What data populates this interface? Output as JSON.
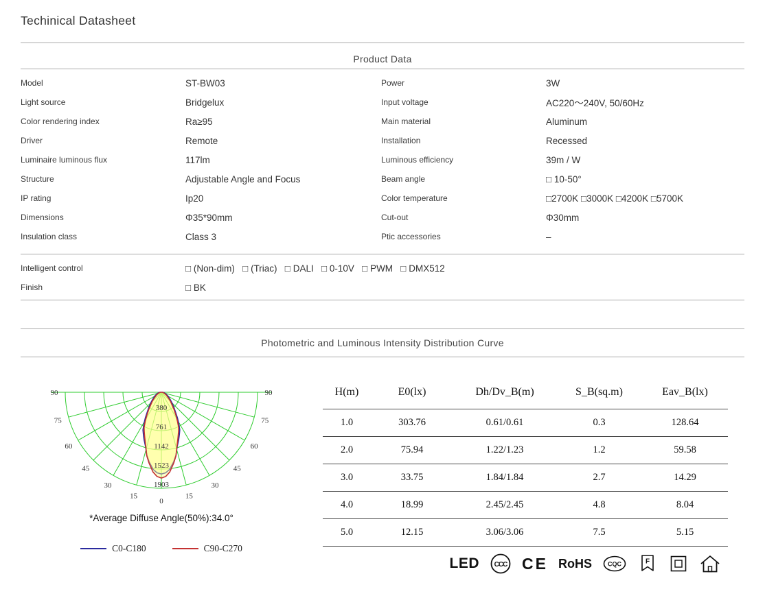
{
  "page": {
    "title": "Techinical Datasheet"
  },
  "product_data": {
    "section_title": "Product Data",
    "left_rows": [
      {
        "label": "Model",
        "value": "ST-BW03"
      },
      {
        "label": "Light source",
        "value": "Bridgelux"
      },
      {
        "label": "Color rendering index",
        "value": "Ra≥95"
      },
      {
        "label": "Driver",
        "value": "Remote"
      },
      {
        "label": "Luminaire luminous flux",
        "value": "117lm"
      },
      {
        "label": "Structure",
        "value": "Adjustable Angle and Focus"
      },
      {
        "label": "IP  rating",
        "value": "Ip20"
      },
      {
        "label": "Dimensions",
        "value": "Φ35*90mm"
      },
      {
        "label": "Insulation class",
        "value": "Class 3"
      }
    ],
    "right_rows": [
      {
        "label": "Power",
        "value": "3W"
      },
      {
        "label": "Input voltage",
        "value": "AC220～240V, 50/60Hz"
      },
      {
        "label": "Main material",
        "value": "Aluminum"
      },
      {
        "label": "Installation",
        "value": "Recessed"
      },
      {
        "label": "Luminous efficiency",
        "value": "39m / W"
      },
      {
        "label": "Beam angle",
        "value": "□ 10-50°"
      },
      {
        "label": "Color temperature",
        "value": "□2700K □3000K □4200K □5700K"
      },
      {
        "label": "Cut-out",
        "value": "Φ30mm"
      },
      {
        "label": "Ptic accessories",
        "value": "–"
      }
    ],
    "full_rows": [
      {
        "label": "Intelligent control",
        "value": "□ (Non-dim)   □ (Triac)   □ DALI   □ 0-10V   □ PWM   □ DMX512"
      },
      {
        "label": "Finish",
        "value": "□ BK"
      }
    ]
  },
  "photometric": {
    "section_title": "Photometric and Luminous Intensity Distribution Curve"
  },
  "chart_data": [
    {
      "type": "line",
      "subtype": "polar-luminous-intensity-distribution",
      "title": "Photometric and Luminous Intensity Distribution Curve",
      "grid_color": "#2ecc2e",
      "lobe_fill": "rgba(255,255,140,0.45)",
      "rmax": 1903,
      "radial_ticks_cd": [
        380,
        761,
        1142,
        1523,
        1903
      ],
      "angle_ticks_deg": [
        0,
        15,
        30,
        45,
        60,
        75,
        90
      ],
      "annotation": "*Average Diffuse Angle(50%):34.0°",
      "series": [
        {
          "name": "C0-C180",
          "color": "#2b2b9e",
          "points": [
            [
              0,
              1620
            ],
            [
              3,
              1600
            ],
            [
              6,
              1540
            ],
            [
              10,
              1400
            ],
            [
              13,
              1280
            ],
            [
              16,
              1130
            ],
            [
              20,
              1000
            ],
            [
              23,
              910
            ],
            [
              26,
              830
            ],
            [
              29,
              710
            ],
            [
              32,
              600
            ],
            [
              36,
              470
            ],
            [
              40,
              380
            ],
            [
              45,
              295
            ],
            [
              50,
              230
            ],
            [
              60,
              150
            ],
            [
              70,
              95
            ],
            [
              80,
              55
            ],
            [
              90,
              30
            ]
          ]
        },
        {
          "name": "C90-C270",
          "color": "#c43232",
          "points": [
            [
              0,
              1700
            ],
            [
              3,
              1670
            ],
            [
              6,
              1590
            ],
            [
              10,
              1420
            ],
            [
              13,
              1290
            ],
            [
              16,
              1120
            ],
            [
              20,
              960
            ],
            [
              23,
              865
            ],
            [
              26,
              780
            ],
            [
              29,
              660
            ],
            [
              32,
              550
            ],
            [
              36,
              430
            ],
            [
              40,
              330
            ],
            [
              45,
              255
            ],
            [
              50,
              190
            ],
            [
              60,
              115
            ],
            [
              70,
              65
            ],
            [
              80,
              35
            ],
            [
              90,
              18
            ]
          ]
        }
      ]
    },
    {
      "type": "table",
      "headers": [
        "H(m)",
        "E0(lx)",
        "Dh/Dv_B(m)",
        "S_B(sq.m)",
        "Eav_B(lx)"
      ],
      "rows": [
        [
          "1.0",
          "303.76",
          "0.61/0.61",
          "0.3",
          "128.64"
        ],
        [
          "2.0",
          "75.94",
          "1.22/1.23",
          "1.2",
          "59.58"
        ],
        [
          "3.0",
          "33.75",
          "1.84/1.84",
          "2.7",
          "14.29"
        ],
        [
          "4.0",
          "18.99",
          "2.45/2.45",
          "4.8",
          "8.04"
        ],
        [
          "5.0",
          "12.15",
          "3.06/3.06",
          "7.5",
          "5.15"
        ]
      ]
    }
  ],
  "certifications": {
    "led_label": "LED",
    "ccc_label": "CCC",
    "ce_label": "CE",
    "rohs_label": "RoHS",
    "cqc_label": "CQC",
    "f_label": "F"
  }
}
